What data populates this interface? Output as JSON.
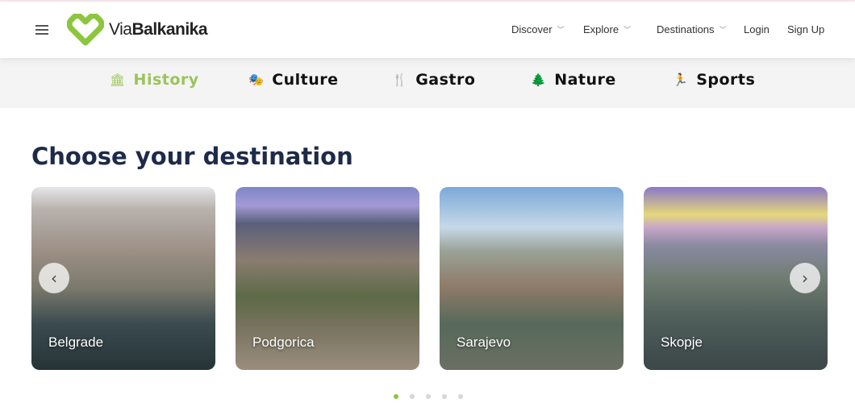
{
  "header": {
    "logo_brand_light": "Via",
    "logo_brand_bold": "Balkanika",
    "nav": [
      {
        "label": "Discover",
        "dropdown": true
      },
      {
        "label": "Explore",
        "dropdown": true
      },
      {
        "label": "Destinations",
        "dropdown": true
      }
    ],
    "login": "Login",
    "signup": "Sign Up"
  },
  "categories": [
    {
      "label": "History",
      "icon": "landmark-icon",
      "active": true
    },
    {
      "label": "Culture",
      "icon": "theater-masks-icon"
    },
    {
      "label": "Gastro",
      "icon": "utensils-icon"
    },
    {
      "label": "Nature",
      "icon": "tree-icon"
    },
    {
      "label": "Sports",
      "icon": "running-icon"
    }
  ],
  "section_title": "Choose your destination",
  "destinations": [
    "Belgrade",
    "Podgorica",
    "Sarajevo",
    "Skopje"
  ],
  "carousel": {
    "pages": 5,
    "current": 1,
    "prev": "‹",
    "next": "›"
  },
  "colors": {
    "accent": "#8cc63f",
    "title": "#1e2a4a"
  }
}
